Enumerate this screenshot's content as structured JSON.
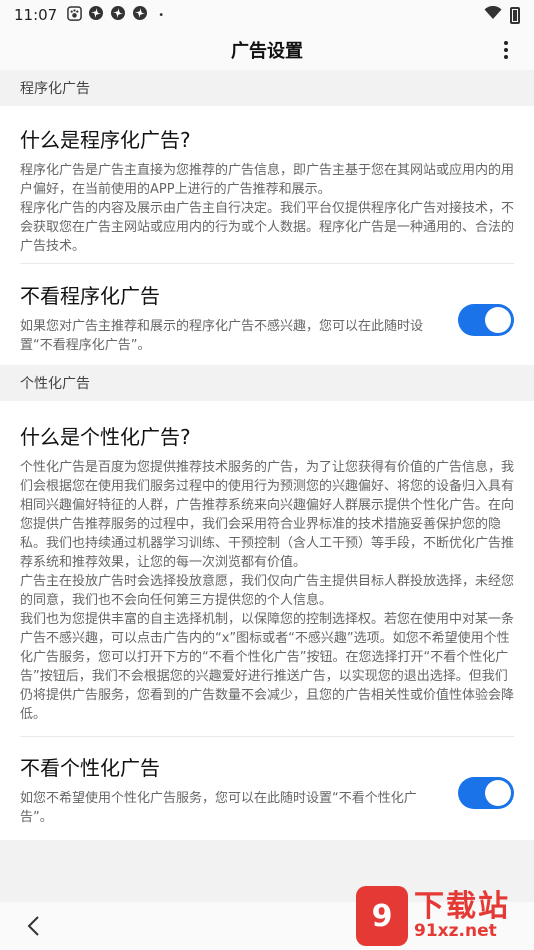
{
  "status_bar": {
    "time": "11:07",
    "dot": "•"
  },
  "app_bar": {
    "title": "广告设置"
  },
  "section1": {
    "header": "程序化广告",
    "card_title": "什么是程序化广告?",
    "card_desc": "程序化广告是广告主直接为您推荐的广告信息，即广告主基于您在其网站或应用内的用户偏好，在当前使用的APP上进行的广告推荐和展示。\n程序化广告的内容及展示由广告主自行决定。我们平台仅提供程序化广告对接技术，不会获取您在广告主网站或应用内的行为或个人数据。程序化广告是一种通用的、合法的广告技术。",
    "toggle_title": "不看程序化广告",
    "toggle_desc": "如果您对广告主推荐和展示的程序化广告不感兴趣，您可以在此随时设置“不看程序化广告”。",
    "toggle_on": true
  },
  "section2": {
    "header": "个性化广告",
    "card_title": "什么是个性化广告?",
    "card_desc": "个性化广告是百度为您提供推荐技术服务的广告，为了让您获得有价值的广告信息，我们会根据您在使用我们服务过程中的使用行为预测您的兴趣偏好、将您的设备归入具有相同兴趣偏好特征的人群，广告推荐系统来向兴趣偏好人群展示提供个性化广告。在向您提供广告推荐服务的过程中，我们会采用符合业界标准的技术措施妥善保护您的隐私。我们也持续通过机器学习训练、干预控制（含人工干预）等手段，不断优化广告推荐系统和推荐效果，让您的每一次浏览都有价值。\n广告主在投放广告时会选择投放意愿，我们仅向广告主提供目标人群投放选择，未经您的同意，我们也不会向任何第三方提供您的个人信息。\n我们也为您提供丰富的自主选择机制，以保障您的控制选择权。若您在使用中对某一条广告不感兴趣，可以点击广告内的“x”图标或者“不感兴趣”选项。如您不希望使用个性化广告服务，您可以打开下方的“不看个性化广告”按钮。在您选择打开“不看个性化广告”按钮后，我们不会根据您的兴趣爱好进行推送广告，以实现您的退出选择。但我们仍将提供广告服务，您看到的广告数量不会减少，且您的广告相关性或价值性体验会降低。",
    "toggle_title": "不看个性化广告",
    "toggle_desc": "如您不希望使用个性化广告服务，您可以在此随时设置“不看个性化广告”。",
    "toggle_on": true
  },
  "watermark": {
    "logo_text": "9",
    "big": "下载站",
    "small": "91xz.net"
  },
  "colors": {
    "accent": "#1a73e8",
    "watermark": "#e53935"
  }
}
